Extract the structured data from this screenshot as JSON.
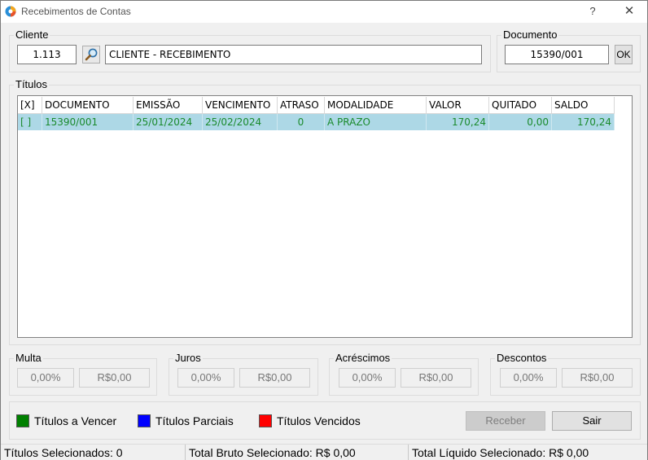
{
  "window": {
    "title": "Recebimentos de Contas",
    "help_label": "?",
    "close_label": "✕",
    "icon": "app-logo-icon"
  },
  "cliente": {
    "group_label": "Cliente",
    "code": "1.113",
    "name": "CLIENTE - RECEBIMENTO",
    "search_icon": "magnifier-icon"
  },
  "documento": {
    "group_label": "Documento",
    "value": "15390/001",
    "ok_label": "OK"
  },
  "titulos": {
    "group_label": "Títulos",
    "columns": [
      "[X]",
      "DOCUMENTO",
      "EMISSÃO",
      "VENCIMENTO",
      "ATRASO",
      "MODALIDADE",
      "VALOR",
      "QUITADO",
      "SALDO"
    ],
    "rows": [
      {
        "selected": "[ ]",
        "documento": "15390/001",
        "emissao": "25/01/2024",
        "vencimento": "25/02/2024",
        "atraso": "0",
        "modalidade": "A PRAZO",
        "valor": "170,24",
        "quitado": "0,00",
        "saldo": "170,24"
      }
    ],
    "row_color": "#add8e6",
    "text_color": "#1a8a2c"
  },
  "multa": {
    "label": "Multa",
    "percent": "0,00%",
    "amount": "R$0,00"
  },
  "juros": {
    "label": "Juros",
    "percent": "0,00%",
    "amount": "R$0,00"
  },
  "acrescimos": {
    "label": "Acréscimos",
    "percent": "0,00%",
    "amount": "R$0,00"
  },
  "descontos": {
    "label": "Descontos",
    "percent": "0,00%",
    "amount": "R$0,00"
  },
  "legend": [
    {
      "label": "Títulos a Vencer",
      "color": "#008000"
    },
    {
      "label": "Títulos Parciais",
      "color": "#0000ff"
    },
    {
      "label": "Títulos Vencidos",
      "color": "#ff0000"
    }
  ],
  "actions": {
    "receber_label": "Receber",
    "sair_label": "Sair"
  },
  "status": {
    "selecionados": "Títulos Selecionados: 0",
    "bruto": "Total Bruto Selecionado: R$ 0,00",
    "liquido": "Total Líquido Selecionado: R$ 0,00"
  }
}
